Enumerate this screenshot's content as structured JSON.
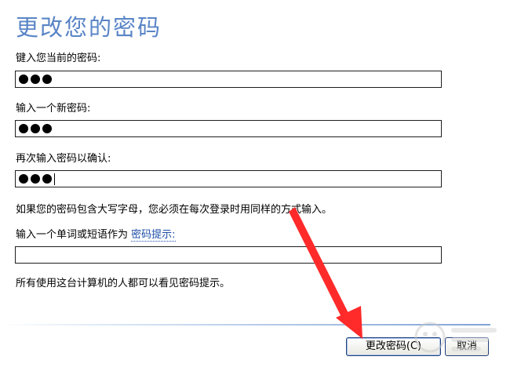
{
  "dialog": {
    "title": "更改您的密码",
    "current_password_label": "键入您当前的密码:",
    "current_password_dots": 3,
    "new_password_label": "输入一个新密码:",
    "new_password_dots": 3,
    "confirm_password_label": "再次输入密码以确认:",
    "confirm_password_dots": 3,
    "case_notice": "如果您的密码包含大写字母，您必须在每次登录时用同样的方式输入。",
    "hint_label_prefix": "输入一个单词或短语作为",
    "hint_link": "密码提示:",
    "hint_value": "",
    "hint_notice": "所有使用这台计算机的人都可以看见密码提示。"
  },
  "buttons": {
    "change_password": "更改密码(C)",
    "cancel": "取消"
  },
  "annotation": {
    "arrow_color": "#ff2a2a"
  },
  "colors": {
    "title": "#5a85c6",
    "link": "#1c4ea8"
  }
}
